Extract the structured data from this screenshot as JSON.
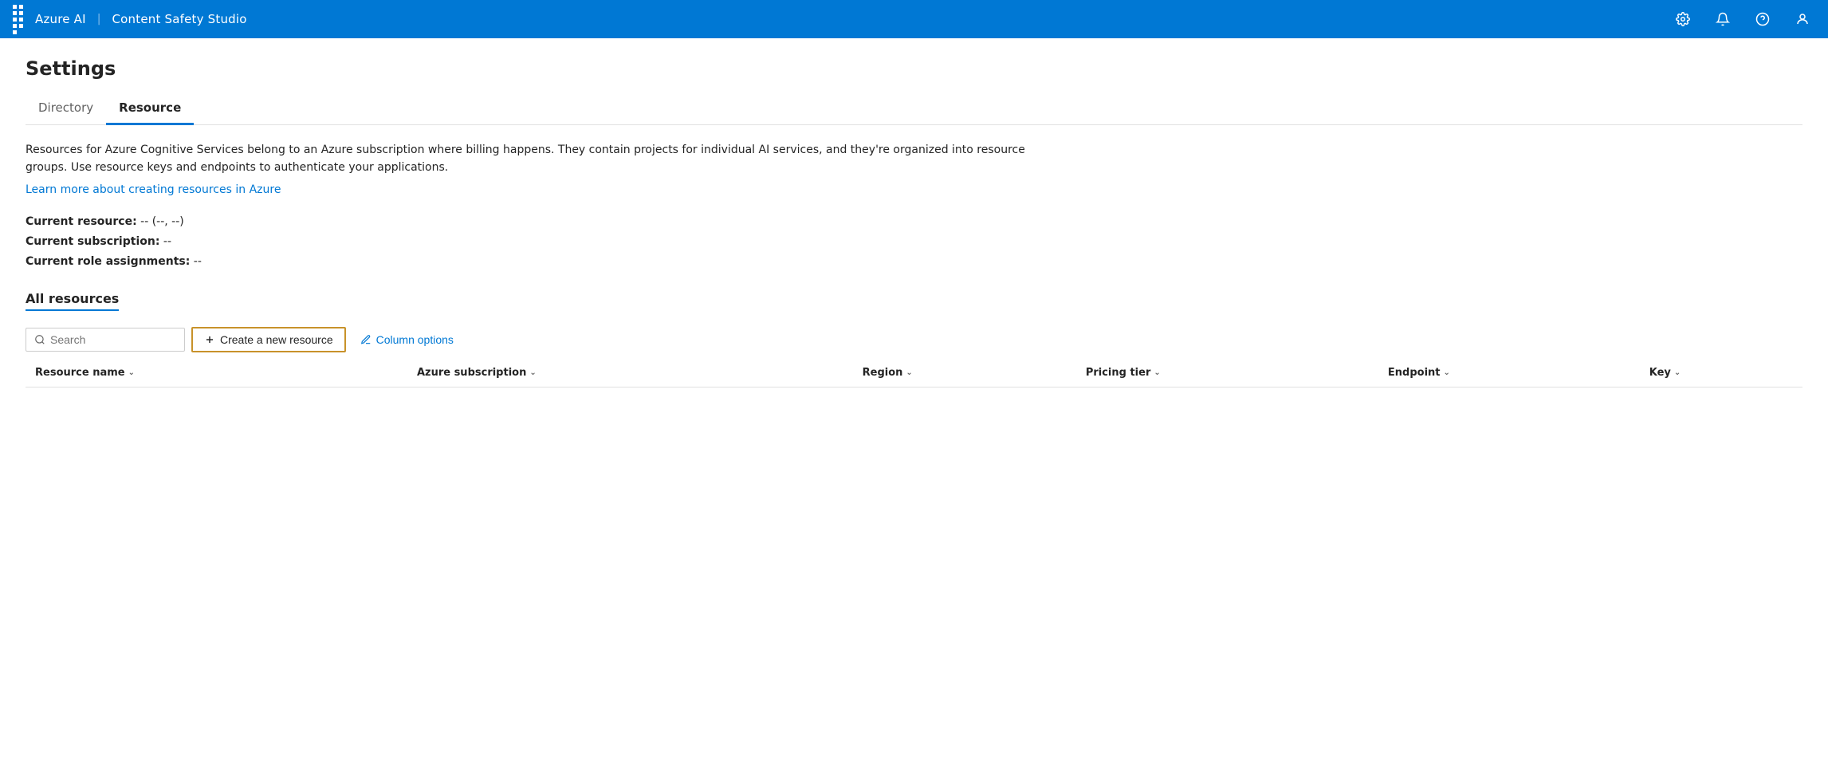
{
  "topbar": {
    "app_name": "Azure AI",
    "divider": "|",
    "app_subtitle": "Content Safety Studio",
    "icons": {
      "settings": "⚙",
      "notifications": "🔔",
      "help": "?",
      "account": "😊"
    }
  },
  "page": {
    "title": "Settings"
  },
  "tabs": [
    {
      "id": "directory",
      "label": "Directory",
      "active": false
    },
    {
      "id": "resource",
      "label": "Resource",
      "active": true
    }
  ],
  "description": {
    "text": "Resources for Azure Cognitive Services belong to an Azure subscription where billing happens. They contain projects for individual AI services, and they're organized into resource groups. Use resource keys and endpoints to authenticate your applications.",
    "learn_more_link": "Learn more about creating resources in Azure"
  },
  "resource_info": {
    "current_resource_label": "Current resource:",
    "current_resource_value": "-- (--, --)",
    "current_subscription_label": "Current subscription:",
    "current_subscription_value": "--",
    "current_role_label": "Current role assignments:",
    "current_role_value": "--"
  },
  "all_resources": {
    "section_title": "All resources"
  },
  "toolbar": {
    "search_placeholder": "Search",
    "create_button_label": "Create a new resource",
    "column_options_label": "Column options"
  },
  "table": {
    "columns": [
      {
        "id": "resource_name",
        "label": "Resource name"
      },
      {
        "id": "azure_subscription",
        "label": "Azure subscription"
      },
      {
        "id": "region",
        "label": "Region"
      },
      {
        "id": "pricing_tier",
        "label": "Pricing tier"
      },
      {
        "id": "endpoint",
        "label": "Endpoint"
      },
      {
        "id": "key",
        "label": "Key"
      }
    ],
    "rows": []
  }
}
